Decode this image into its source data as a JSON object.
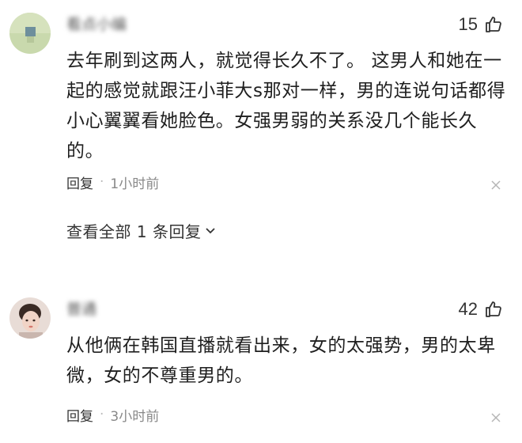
{
  "comments": [
    {
      "username": "看点小编",
      "likes": "15",
      "content": "去年刷到这两人，就觉得长久不了。 这男人和她在一起的感觉就跟汪小菲大s那对一样，男的连说句话都得小心翼翼看她脸色。女强男弱的关系没几个能长久的。",
      "reply_label": "回复",
      "separator": "·",
      "time": "1小时前",
      "view_replies": "查看全部 1 条回复"
    },
    {
      "username": "普通",
      "likes": "42",
      "content": "从他俩在韩国直播就看出来，女的太强势，男的太卑微，女的不尊重男的。",
      "reply_label": "回复",
      "separator": "·",
      "time": "3小时前"
    }
  ],
  "icons": {
    "like": "thumbs-up-icon",
    "close": "close-icon",
    "chevron": "chevron-down-icon"
  },
  "colors": {
    "text": "#1f1f1f",
    "meta": "#888888",
    "icon": "#333333"
  }
}
